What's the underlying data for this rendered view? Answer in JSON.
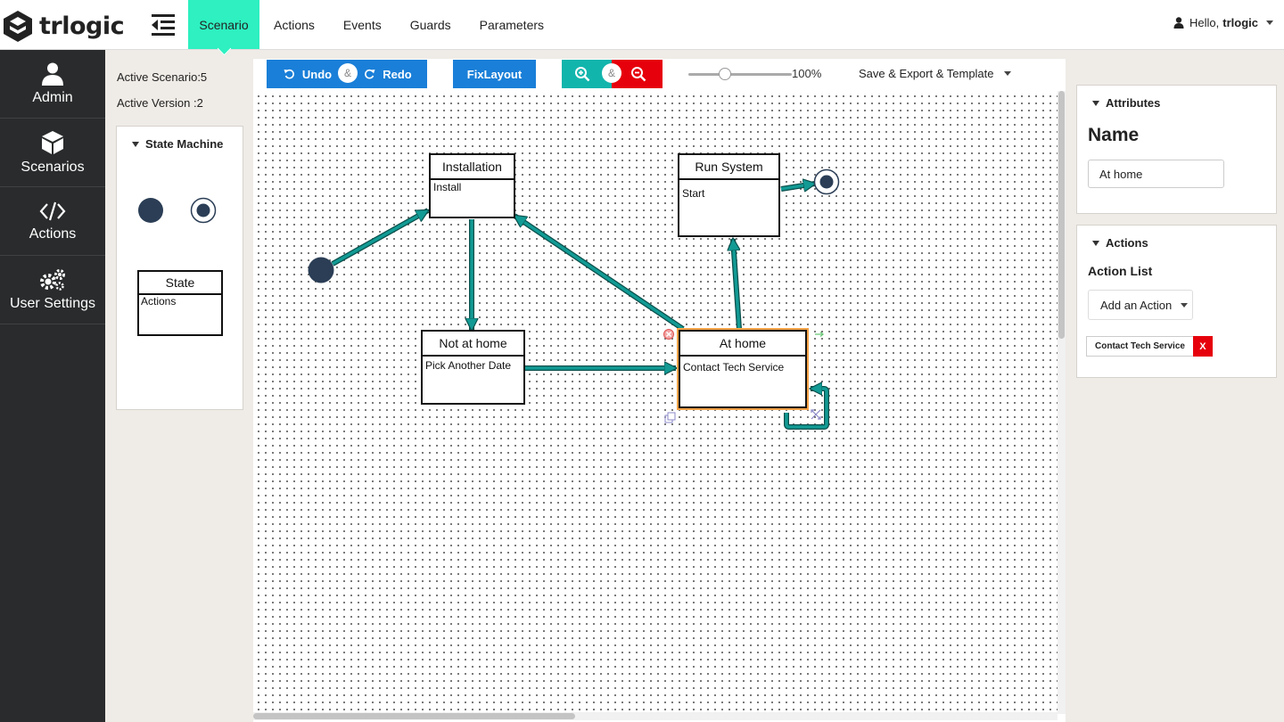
{
  "brand": {
    "name": "trlogic"
  },
  "nav": {
    "tabs": [
      "Scenario",
      "Actions",
      "Events",
      "Guards",
      "Parameters"
    ],
    "active": "Scenario"
  },
  "user": {
    "greeting": "Hello,",
    "name": "trlogic"
  },
  "sidebar": {
    "items": [
      {
        "label": "Admin",
        "icon": "user-icon"
      },
      {
        "label": "Scenarios",
        "icon": "cube-icon"
      },
      {
        "label": "Actions",
        "icon": "code-icon"
      },
      {
        "label": "User Settings",
        "icon": "gears-icon"
      }
    ]
  },
  "info": {
    "active_scenario": "Active Scenario:5",
    "active_version": "Active Version :2"
  },
  "palette": {
    "title": "State Machine",
    "state_template": {
      "name": "State",
      "body": "Actions"
    }
  },
  "toolbar": {
    "undo": "Undo",
    "redo": "Redo",
    "amp": "&",
    "fix_layout": "FixLayout",
    "zoom": "100%",
    "zoom_level": 0.35,
    "export": "Save & Export & Template"
  },
  "diagram": {
    "states": [
      {
        "name": "Installation",
        "body": "Install"
      },
      {
        "name": "Run System",
        "body": "Start"
      },
      {
        "name": "Not at home",
        "body": "Pick Another Date"
      },
      {
        "name": "At home",
        "body": "Contact Tech Service",
        "selected": true
      }
    ]
  },
  "attributes": {
    "title": "Attributes",
    "name_heading": "Name",
    "name_value": "At home"
  },
  "actions_panel": {
    "title": "Actions",
    "list_label": "Action List",
    "add_button": "Add an Action",
    "items": [
      "Contact Tech Service"
    ],
    "remove_label": "X"
  },
  "colors": {
    "accent": "#2ef0c0",
    "sidebar": "#292b2c",
    "primary_button": "#1a7fd8",
    "zoom_in": "#12b5ac",
    "zoom_out": "#e6000b",
    "transition": "#129a94",
    "node": "#2b3e56",
    "selection": "#f4a247"
  }
}
